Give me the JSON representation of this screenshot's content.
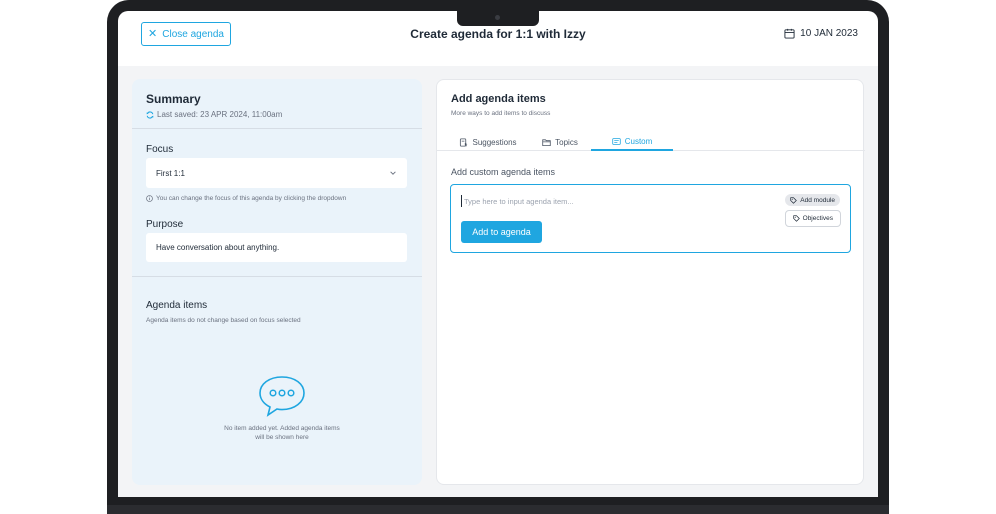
{
  "header": {
    "close_label": "Close agenda",
    "title": "Create agenda for 1:1 with Izzy",
    "date": "10 JAN 2023"
  },
  "summary": {
    "title": "Summary",
    "last_saved": "Last saved: 23 APR 2024, 11:00am",
    "focus_label": "Focus",
    "focus_value": "First 1:1",
    "focus_hint": "You can change the focus of this agenda by clicking  the dropdown",
    "purpose_label": "Purpose",
    "purpose_value": "Have conversation about anything.",
    "agenda_label": "Agenda items",
    "agenda_sub": "Agenda items do not change based on focus selected",
    "empty_line1": "No item added yet. Added agenda items",
    "empty_line2": "will be shown here"
  },
  "add_panel": {
    "title": "Add agenda items",
    "subtitle": "More ways to add items to discuss",
    "tabs": [
      {
        "label": "Suggestions",
        "icon": "suggestion-icon"
      },
      {
        "label": "Topics",
        "icon": "folder-icon"
      },
      {
        "label": "Custom",
        "icon": "custom-icon",
        "active": true
      }
    ],
    "custom_label": "Add custom agenda items",
    "input_placeholder": "Type here to input agenda item...",
    "input_value": "",
    "chip_module": "Add module",
    "chip_objectives": "Objectives",
    "add_button": "Add to agenda"
  },
  "colors": {
    "accent": "#1fa6e0",
    "summary_bg": "#eaf3fa",
    "content_bg": "#f3f4f6"
  }
}
